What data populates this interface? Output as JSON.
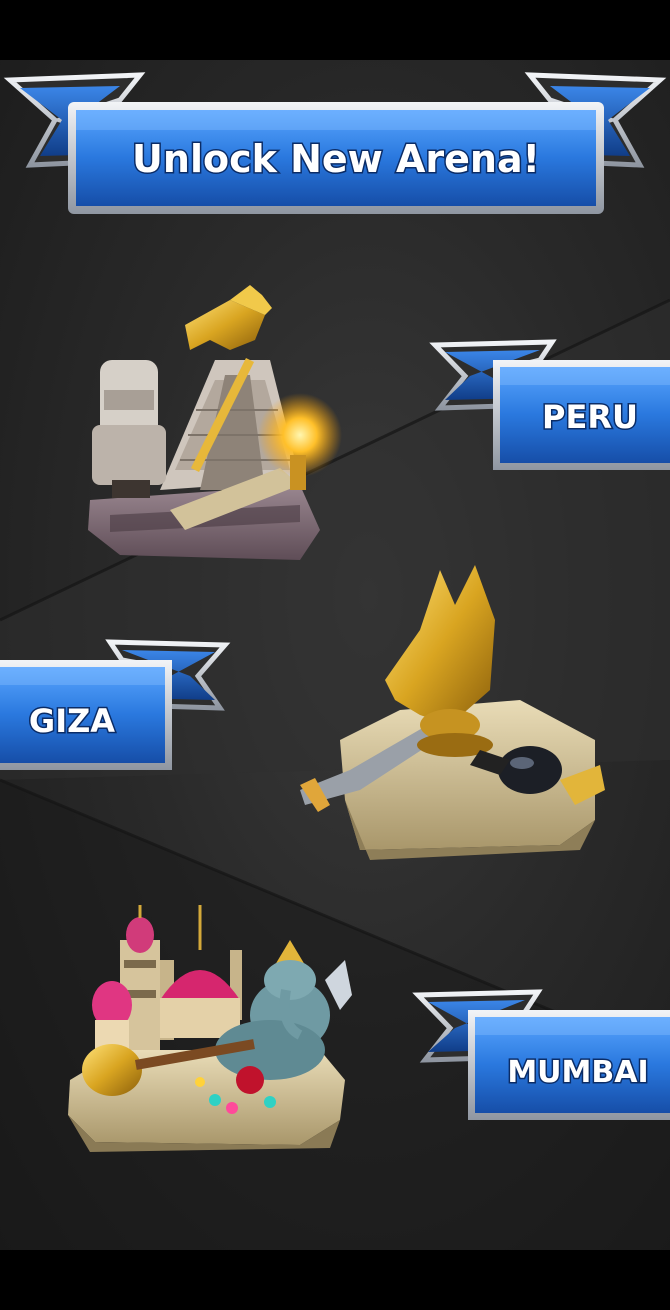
{
  "banner": {
    "title": "Unlock New Arena!"
  },
  "arenas": [
    {
      "label": "PERU",
      "icon": "peru-arena-icon"
    },
    {
      "label": "GIZA",
      "icon": "giza-arena-icon"
    },
    {
      "label": "MUMBAI",
      "icon": "mumbai-arena-icon"
    }
  ],
  "colors": {
    "ribbon_blue": "#2f7fe0",
    "ribbon_dark": "#1a4fae",
    "silver": "#c9ced6",
    "background": "#2a2a2a"
  }
}
